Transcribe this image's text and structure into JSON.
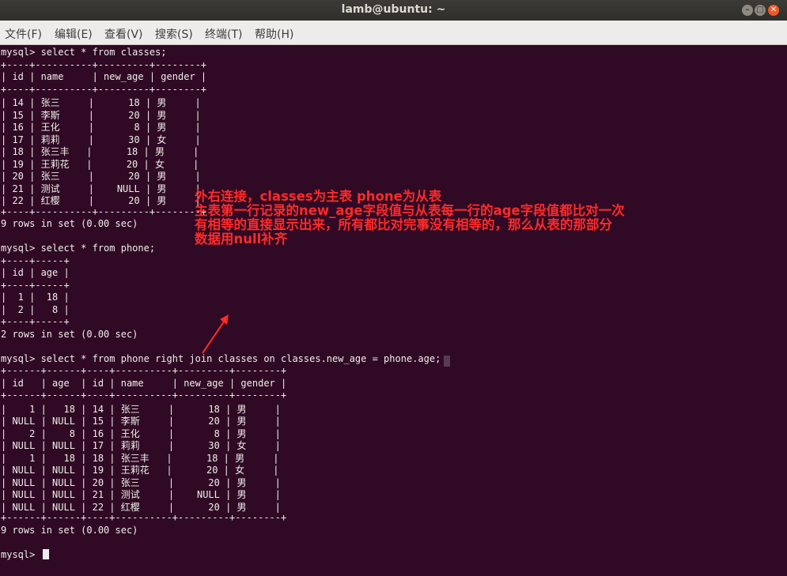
{
  "window": {
    "title": "lamb@ubuntu: ~",
    "buttons": {
      "minimize": "–",
      "maximize": "□",
      "close": "✕"
    }
  },
  "menu": [
    "文件(F)",
    "编辑(E)",
    "查看(V)",
    "搜索(S)",
    "终端(T)",
    "帮助(H)"
  ],
  "terminal": {
    "lines": [
      "mysql> select * from classes;",
      "+----+----------+---------+--------+",
      "| id | name     | new_age | gender |",
      "+----+----------+---------+--------+",
      "| 14 | 张三     |      18 | 男     |",
      "| 15 | 李斯     |      20 | 男     |",
      "| 16 | 王化     |       8 | 男     |",
      "| 17 | 莉莉     |      30 | 女     |",
      "| 18 | 张三丰   |      18 | 男     |",
      "| 19 | 王莉花   |      20 | 女     |",
      "| 20 | 张三     |      20 | 男     |",
      "| 21 | 测试     |    NULL | 男     |",
      "| 22 | 红樱     |      20 | 男     |",
      "+----+----------+---------+--------+",
      "9 rows in set (0.00 sec)",
      "",
      "mysql> select * from phone;",
      "+----+-----+",
      "| id | age |",
      "+----+-----+",
      "|  1 |  18 |",
      "|  2 |   8 |",
      "+----+-----+",
      "2 rows in set (0.00 sec)",
      "",
      "mysql> select * from phone right join classes on classes.new_age = phone.age;",
      "+------+------+----+----------+---------+--------+",
      "| id   | age  | id | name     | new_age | gender |",
      "+------+------+----+----------+---------+--------+",
      "|    1 |   18 | 14 | 张三     |      18 | 男     |",
      "| NULL | NULL | 15 | 李斯     |      20 | 男     |",
      "|    2 |    8 | 16 | 王化     |       8 | 男     |",
      "| NULL | NULL | 17 | 莉莉     |      30 | 女     |",
      "|    1 |   18 | 18 | 张三丰   |      18 | 男     |",
      "| NULL | NULL | 19 | 王莉花   |      20 | 女     |",
      "| NULL | NULL | 20 | 张三     |      20 | 男     |",
      "| NULL | NULL | 21 | 测试     |    NULL | 男     |",
      "| NULL | NULL | 22 | 红樱     |      20 | 男     |",
      "+------+------+----+----------+---------+--------+",
      "9 rows in set (0.00 sec)",
      "",
      "mysql> "
    ]
  },
  "annotation": {
    "lines": [
      "外右连接，classes为主表 phone为从表",
      "主表第一行记录的new_age字段值与从表每一行的age字段值都比对一次",
      "有相等的直接显示出来，所有都比对完事没有相等的，那么从表的那部分",
      "数据用null补齐"
    ],
    "color": "#ff2a2a"
  },
  "colors": {
    "terminal_bg": "#300a24",
    "terminal_fg": "#eeeeec"
  }
}
